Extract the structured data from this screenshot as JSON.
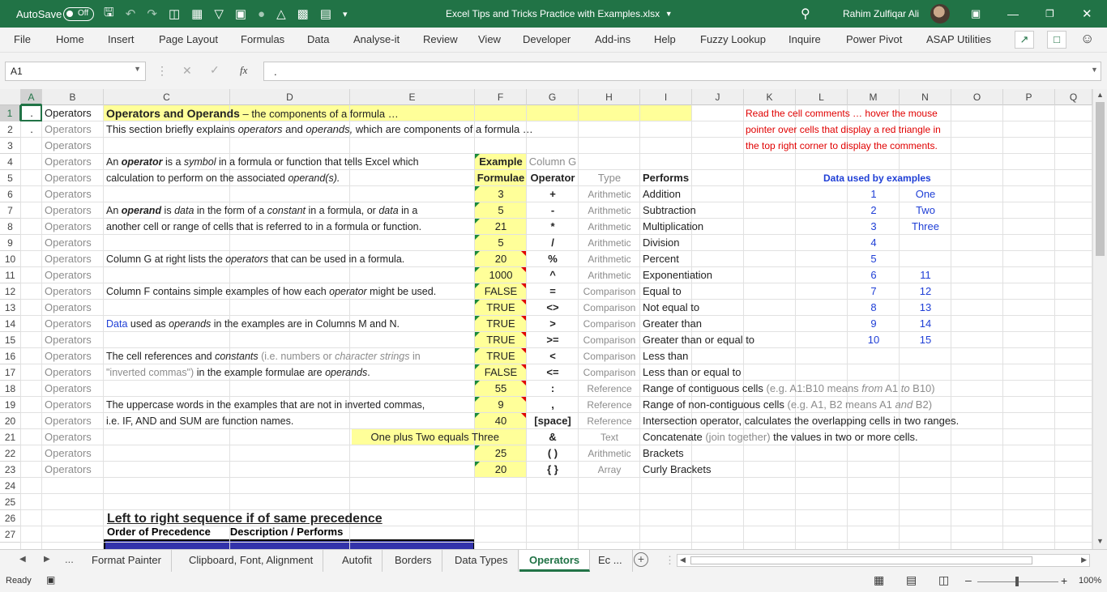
{
  "titlebar": {
    "autosave_label": "AutoSave",
    "autosave_state": "Off",
    "file_title": "Excel Tips and Tricks Practice with Examples.xlsx",
    "user_name": "Rahim Zulfiqar Ali",
    "accent": "#217346"
  },
  "menu": [
    "File",
    "Home",
    "Insert",
    "Page Layout",
    "Formulas",
    "Data",
    "Analyse-it",
    "Review",
    "View",
    "Developer",
    "Add-ins",
    "Help",
    "Fuzzy Lookup",
    "Inquire",
    "Power Pivot",
    "ASAP Utilities"
  ],
  "formula_bar": {
    "name_box": "A1",
    "fx": "fx",
    "content": "."
  },
  "columns": [
    "A",
    "B",
    "C",
    "D",
    "E",
    "F",
    "G",
    "H",
    "I",
    "J",
    "K",
    "L",
    "M",
    "N",
    "O",
    "P",
    "Q"
  ],
  "rows": [
    "1",
    "2",
    "3",
    "4",
    "5",
    "6",
    "7",
    "8",
    "9",
    "10",
    "11",
    "12",
    "13",
    "14",
    "15",
    "16",
    "17",
    "18",
    "19",
    "20",
    "21",
    "22",
    "23",
    "24",
    "25",
    "26",
    "27"
  ],
  "cells": {
    "a1": ".",
    "a2": ".",
    "b_label": "Operators",
    "c1_bold": "Operators and Operands",
    "c1_rest": " – the components of a formula …",
    "c2_a": "This section briefly explains ",
    "c2_b": "operators",
    "c2_c": " and ",
    "c2_d": "operands,",
    "c2_e": " which are components of a formula …",
    "c4_a": "An ",
    "c4_b": "operator",
    "c4_c": " is a ",
    "c4_d": "symbol",
    "c4_e": " in a formula or function that tells Excel which",
    "c5_a": "calculation to perform on the associated ",
    "c5_b": "operand(s).",
    "c7_a": "An ",
    "c7_b": "operand",
    "c7_c": " is ",
    "c7_d": "data",
    "c7_e": " in the form of a ",
    "c7_f": "constant",
    "c7_g": " in a formula, or ",
    "c7_h": "data",
    "c7_i": " in a",
    "c8": "another cell or range of cells that is referred to in a formula or function.",
    "c10_a": "Column G at right lists the ",
    "c10_b": "operators",
    "c10_c": " that can be used in a formula.",
    "c12_a": "Column F contains simple examples of how each ",
    "c12_b": "operator",
    "c12_c": " might be used.",
    "c14_a": "Data",
    "c14_b": " used as ",
    "c14_c": "operands",
    "c14_d": " in the examples are in Columns M and N.",
    "c16_a": "The cell references and ",
    "c16_b": "constants",
    "c16_c": " (i.e. numbers or ",
    "c16_d": "character strings",
    "c16_e": " in",
    "c17_a": "\"inverted commas\")",
    "c17_b": " in the example formulae are ",
    "c17_c": "operands",
    "c17_d": ".",
    "c19": "The uppercase words in the examples that are not in inverted commas,",
    "c20": "i.e. IF, AND and SUM are function names.",
    "f4": "Example",
    "f5": "Formulae",
    "g4": "Column G",
    "g5": "Operator",
    "h5": "Type",
    "i5": "Performs",
    "f21": "One plus Two equals Three",
    "k1": "Read the cell comments … hover the mouse",
    "k2": "pointer over cells that display a red triangle in",
    "k3": "the top right corner to display the comments.",
    "m5": "Data used by examples",
    "c26": "Left to right sequence if of same precedence",
    "c27_a": "Order of Precedence",
    "c27_b": "Description / Performs"
  },
  "operator_rows": [
    {
      "row": 6,
      "f": "3",
      "g": "+",
      "h": "Arithmetic",
      "i": "Addition"
    },
    {
      "row": 7,
      "f": "5",
      "g": "-",
      "h": "Arithmetic",
      "i": "Subtraction"
    },
    {
      "row": 8,
      "f": "21",
      "g": "*",
      "h": "Arithmetic",
      "i": "Multiplication"
    },
    {
      "row": 9,
      "f": "5",
      "g": "/",
      "h": "Arithmetic",
      "i": "Division"
    },
    {
      "row": 10,
      "f": "20",
      "g": "%",
      "h": "Arithmetic",
      "i": "Percent"
    },
    {
      "row": 11,
      "f": "1000",
      "g": "^",
      "h": "Arithmetic",
      "i": "Exponentiation"
    },
    {
      "row": 12,
      "f": "FALSE",
      "g": "=",
      "h": "Comparison",
      "i": "Equal to"
    },
    {
      "row": 13,
      "f": "TRUE",
      "g": "<>",
      "h": "Comparison",
      "i": "Not equal to"
    },
    {
      "row": 14,
      "f": "TRUE",
      "g": ">",
      "h": "Comparison",
      "i": "Greater than"
    },
    {
      "row": 15,
      "f": "TRUE",
      "g": ">=",
      "h": "Comparison",
      "i": "Greater than or equal to"
    },
    {
      "row": 16,
      "f": "TRUE",
      "g": "<",
      "h": "Comparison",
      "i": "Less than"
    },
    {
      "row": 17,
      "f": "FALSE",
      "g": "<=",
      "h": "Comparison",
      "i": "Less than or equal to"
    },
    {
      "row": 18,
      "f": "55",
      "g": ":",
      "h": "Reference",
      "i": "Range of contiguous cells",
      "note_a": " (e.g. A1:B10 means ",
      "note_b": "from",
      "note_c": " A1 ",
      "note_d": "to",
      "note_e": " B10)"
    },
    {
      "row": 19,
      "f": "9",
      "g": ",",
      "h": "Reference",
      "i": "Range of non-contiguous cells",
      "note_a": " (e.g. A1, B2 means A1 ",
      "note_b": "and",
      "note_c": " B2)"
    },
    {
      "row": 20,
      "f": "40",
      "g": "[space]",
      "h": "Reference",
      "i": "Intersection operator, calculates the overlapping cells in two ranges."
    },
    {
      "row": 21,
      "f": "",
      "g": "&",
      "h": "Text",
      "i": "Concatenate",
      "note_a": " (join together)",
      "note_b": " the values in two or more cells."
    },
    {
      "row": 22,
      "f": "25",
      "g": "( )",
      "h": "Arithmetic",
      "i": "Brackets"
    },
    {
      "row": 23,
      "f": "20",
      "g": "{ }",
      "h": "Array",
      "i": "Curly Brackets"
    }
  ],
  "data_m": [
    "1",
    "2",
    "3",
    "4",
    "5",
    "6",
    "7",
    "8",
    "9",
    "10"
  ],
  "data_n": [
    "One",
    "Two",
    "Three",
    "",
    "",
    "11",
    "12",
    "13",
    "14",
    "15"
  ],
  "sheet_tabs": [
    "Format Painter",
    "Clipboard, Font, Alignment",
    "Autofit",
    "Borders",
    "Data Types",
    "Operators",
    "Ec ..."
  ],
  "active_tab": "Operators",
  "status": {
    "ready": "Ready",
    "zoom": "100%"
  }
}
